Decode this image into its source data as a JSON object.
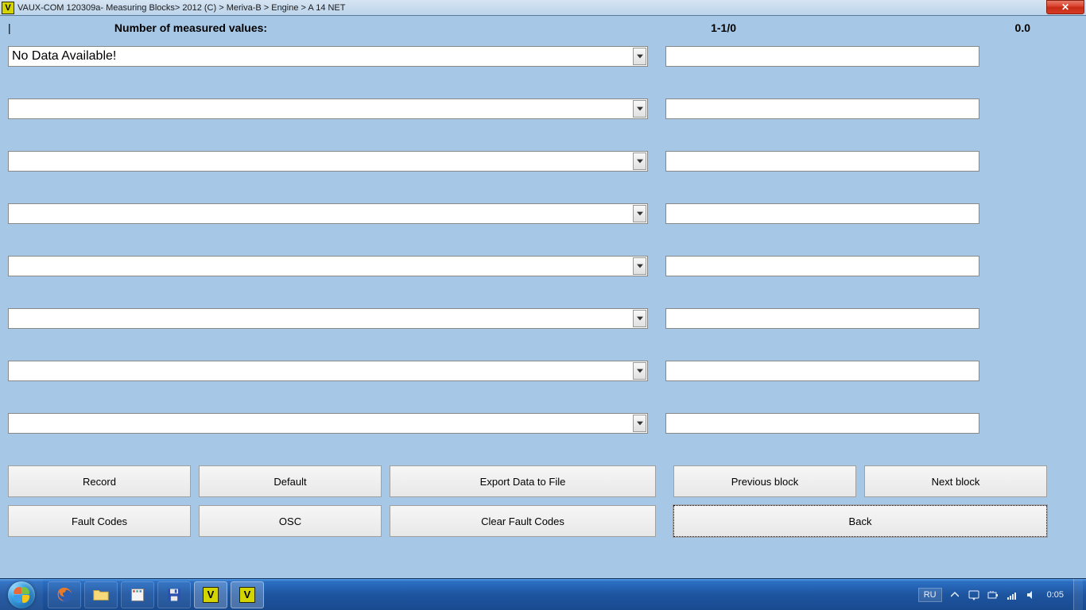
{
  "titlebar": {
    "icon_letter": "V",
    "text": "VAUX-COM 120309a- Measuring Blocks> 2012 (C) > Meriva-B > Engine > A 14 NET"
  },
  "header": {
    "cursor": "|",
    "label": "Number of measured values:",
    "mid_value": "1-1/0",
    "right_value": "0.0"
  },
  "rows": [
    {
      "combo": "No Data Available!",
      "value": ""
    },
    {
      "combo": "",
      "value": ""
    },
    {
      "combo": "",
      "value": ""
    },
    {
      "combo": "",
      "value": ""
    },
    {
      "combo": "",
      "value": ""
    },
    {
      "combo": "",
      "value": ""
    },
    {
      "combo": "",
      "value": ""
    },
    {
      "combo": "",
      "value": ""
    }
  ],
  "buttons": {
    "record": "Record",
    "default": "Default",
    "export": "Export Data to File",
    "previous": "Previous block",
    "next": "Next block",
    "fault_codes": "Fault Codes",
    "osc": "OSC",
    "clear_fault": "Clear Fault Codes",
    "back": "Back"
  },
  "taskbar": {
    "lang": "RU",
    "time": "0:05"
  }
}
